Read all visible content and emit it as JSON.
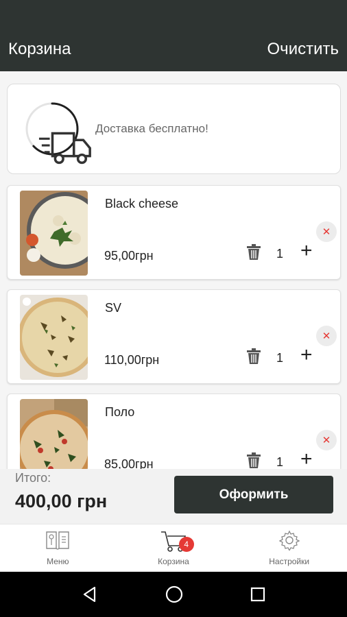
{
  "header": {
    "title": "Корзина",
    "clear_label": "Очистить"
  },
  "delivery": {
    "text": "Доставка бесплатно!",
    "progress": 0.63,
    "icon": "delivery-truck-icon"
  },
  "items": [
    {
      "name": "Black cheese",
      "price": "95,00грн",
      "qty": "1"
    },
    {
      "name": "SV",
      "price": "110,00грн",
      "qty": "1"
    },
    {
      "name": "Поло",
      "price": "85,00грн",
      "qty": "1"
    }
  ],
  "total": {
    "label": "Итого:",
    "value": "400,00 грн"
  },
  "order_button": "Оформить",
  "nav": {
    "menu_label": "Меню",
    "cart_label": "Корзина",
    "cart_badge": "4",
    "settings_label": "Настройки"
  },
  "colors": {
    "primary": "#2e3432",
    "accent": "#e53935",
    "background": "#f5f5f5"
  }
}
